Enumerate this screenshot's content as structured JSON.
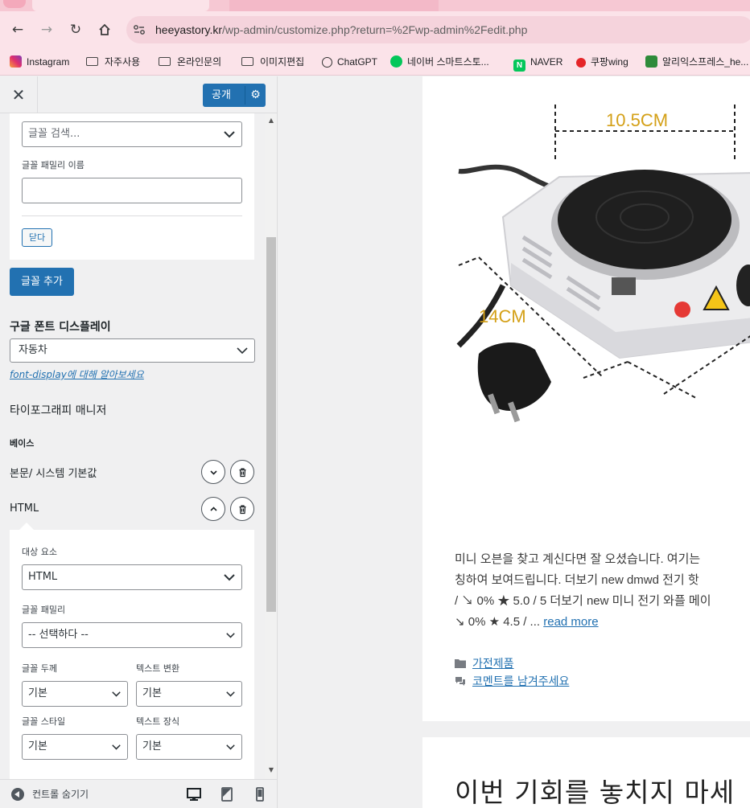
{
  "browser": {
    "url_host": "heeyastory.kr",
    "url_path": "/wp-admin/customize.php?return=%2Fwp-admin%2Fedit.php",
    "bookmarks": [
      {
        "label": "Instagram",
        "icon": "instagram-icon"
      },
      {
        "label": "자주사용",
        "icon": "folder-icon"
      },
      {
        "label": "온라인문의",
        "icon": "folder-icon"
      },
      {
        "label": "이미지편집",
        "icon": "folder-icon"
      },
      {
        "label": "ChatGPT",
        "icon": "chatgpt-icon"
      },
      {
        "label": "네이버 스마트스토...",
        "icon": "smartstore-icon"
      },
      {
        "label": "NAVER",
        "icon": "naver-icon"
      },
      {
        "label": "쿠팡wing",
        "icon": "coupang-icon"
      },
      {
        "label": "알리익스프레스_he...",
        "icon": "aliexpress-icon"
      }
    ]
  },
  "customizer": {
    "publish_label": "공개",
    "font_search_placeholder": "글꼴 검색...",
    "font_family_name_label": "글꼴 패밀리 이름",
    "close_label": "닫다",
    "add_font_label": "글꼴 추가",
    "google_font_display_title": "구글 폰트 디스플레이",
    "google_font_display_value": "자동차",
    "font_display_link": "font-display에 대해 알아보세요",
    "typography_manager_title": "타이포그래피 매니저",
    "base_label": "베이스",
    "items": [
      {
        "label": "본문/ 시스템 기본값",
        "expanded": false
      },
      {
        "label": "HTML",
        "expanded": true
      }
    ],
    "target_element_label": "대상 요소",
    "target_element_value": "HTML",
    "font_family_label": "글꼴 패밀리",
    "font_family_value": "-- 선택하다 --",
    "font_weight_label": "글꼴 두께",
    "font_weight_value": "기본",
    "text_transform_label": "텍스트 변환",
    "text_transform_value": "기본",
    "font_style_label": "글꼴 스타일",
    "font_style_value": "기본",
    "text_decoration_label": "텍스트 장식",
    "text_decoration_value": "기본",
    "hide_controls_label": "컨트롤 숨기기"
  },
  "preview": {
    "image_labels": {
      "top": "10.5CM",
      "side": "14CM"
    },
    "excerpt_lines": [
      "미니 오븐을 찾고 계신다면 잘 오셨습니다. 여기는",
      "칭하여 보여드립니다. 더보기 new dmwd 전기 핫",
      "/ ↘ 0% ★ 5.0 / 5 더보기 new 미니 전기 와플 메이",
      "↘ 0% ★ 4.5 / ..."
    ],
    "read_more": "read more",
    "category_link": "가전제품",
    "comment_link": "코멘트를 남겨주세요",
    "next_post_title": "이번 기회를 놓치지 마세"
  }
}
